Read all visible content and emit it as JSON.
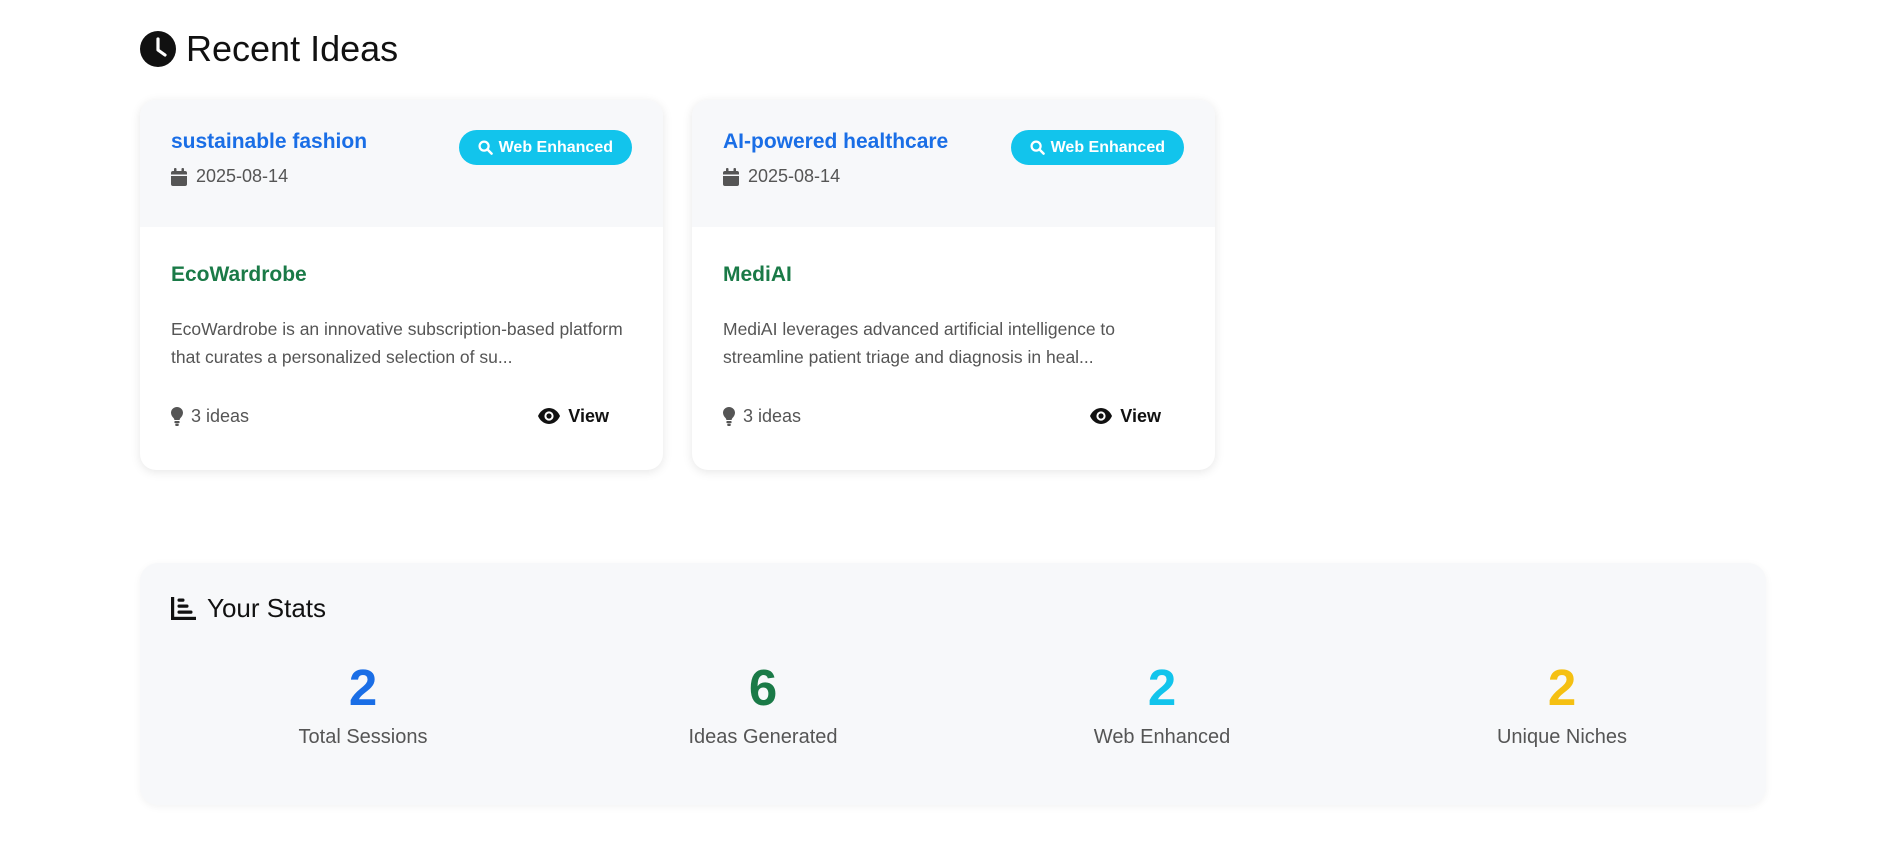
{
  "recent": {
    "title": "Recent Ideas",
    "cards": [
      {
        "niche": "sustainable fashion",
        "date": "2025-08-14",
        "badge": "Web Enhanced",
        "name": "EcoWardrobe",
        "description": "EcoWardrobe is an innovative subscription-based platform that curates a personalized selection of su...",
        "ideas": "3 ideas",
        "view_label": "View"
      },
      {
        "niche": "AI-powered healthcare",
        "date": "2025-08-14",
        "badge": "Web Enhanced",
        "name": "MediAI",
        "description": "MediAI leverages advanced artificial intelligence to streamline patient triage and diagnosis in heal...",
        "ideas": "3 ideas",
        "view_label": "View"
      }
    ]
  },
  "stats": {
    "title": "Your Stats",
    "items": [
      {
        "value": "2",
        "label": "Total Sessions",
        "color": "#1a6ee6"
      },
      {
        "value": "6",
        "label": "Ideas Generated",
        "color": "#1a7a47"
      },
      {
        "value": "2",
        "label": "Web Enhanced",
        "color": "#12c4ec"
      },
      {
        "value": "2",
        "label": "Unique Niches",
        "color": "#f5c012"
      }
    ]
  },
  "colors": {
    "link": "#1a6ee6",
    "success": "#1a7a47",
    "badge": "#12c4ec",
    "warning": "#f5c012"
  },
  "icons": {
    "section": "clock-icon",
    "date": "calendar-icon",
    "badge": "search-icon",
    "ideas": "lightbulb-icon",
    "view": "eye-icon",
    "stats": "chart-bar-icon"
  }
}
